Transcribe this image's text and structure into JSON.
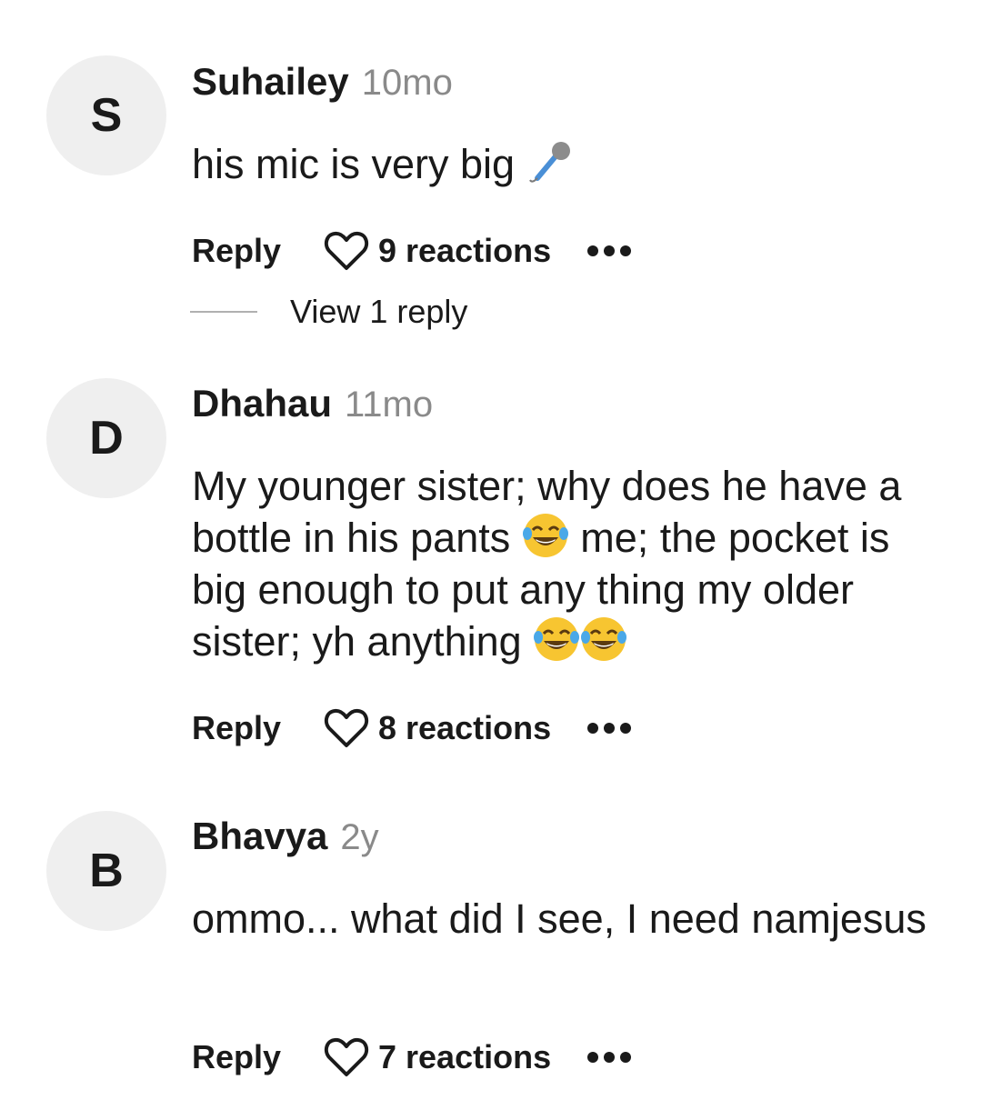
{
  "comments": [
    {
      "avatar_letter": "S",
      "username": "Suhailey",
      "time": "10mo",
      "text": "his mic is very big",
      "emoji_after": "microphone",
      "reply_label": "Reply",
      "reactions": "9 reactions",
      "view_replies": "View 1 reply"
    },
    {
      "avatar_letter": "D",
      "username": "Dhahau",
      "time": "11mo",
      "text_part1": "My younger sister; why does he have a bottle in his pants",
      "text_part2": "me; the pocket is big enough to put any thing my older sister; yh anything",
      "reply_label": "Reply",
      "reactions": "8 reactions"
    },
    {
      "avatar_letter": "B",
      "username": "Bhavya",
      "time": "2y",
      "text": "ommo... what did I see, I need namjesus",
      "reply_label": "Reply",
      "reactions": "7 reactions"
    }
  ],
  "colors": {
    "avatar_bg": "#efefef",
    "time_text": "#8a8a8a",
    "primary_text": "#1a1a1a"
  }
}
